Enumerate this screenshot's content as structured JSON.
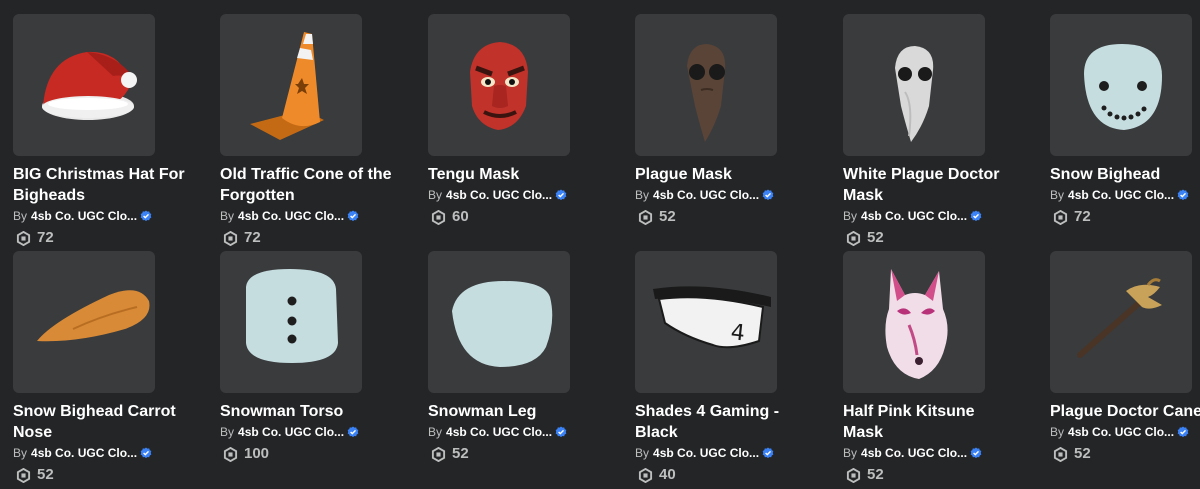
{
  "items": [
    {
      "name": "BIG Christmas Hat For Bigheads",
      "by": "By",
      "creator": "4sb Co. UGC Clo...",
      "price": "72",
      "icon": "santa-hat"
    },
    {
      "name": "Old Traffic Cone of the Forgotten",
      "by": "By",
      "creator": "4sb Co. UGC Clo...",
      "price": "72",
      "icon": "traffic-cone"
    },
    {
      "name": "Tengu Mask",
      "by": "By",
      "creator": "4sb Co. UGC Clo...",
      "price": "60",
      "icon": "tengu-mask"
    },
    {
      "name": "Plague Mask",
      "by": "By",
      "creator": "4sb Co. UGC Clo...",
      "price": "52",
      "icon": "plague-mask"
    },
    {
      "name": "White Plague Doctor Mask",
      "by": "By",
      "creator": "4sb Co. UGC Clo...",
      "price": "52",
      "icon": "white-plague-mask"
    },
    {
      "name": "Snow Bighead",
      "by": "By",
      "creator": "4sb Co. UGC Clo...",
      "price": "72",
      "icon": "snow-bighead"
    },
    {
      "name": "Snow Bighead Carrot Nose",
      "by": "By",
      "creator": "4sb Co. UGC Clo...",
      "price": "52",
      "icon": "carrot-nose"
    },
    {
      "name": "Snowman Torso",
      "by": "By",
      "creator": "4sb Co. UGC Clo...",
      "price": "100",
      "icon": "snowman-torso"
    },
    {
      "name": "Snowman Leg",
      "by": "By",
      "creator": "4sb Co. UGC Clo...",
      "price": "52",
      "icon": "snowman-leg"
    },
    {
      "name": "Shades 4 Gaming - Black",
      "by": "By",
      "creator": "4sb Co. UGC Clo...",
      "price": "40",
      "icon": "shades"
    },
    {
      "name": "Half Pink Kitsune Mask",
      "by": "By",
      "creator": "4sb Co. UGC Clo...",
      "price": "52",
      "icon": "kitsune-mask"
    },
    {
      "name": "Plague Doctor Cane",
      "by": "By",
      "creator": "4sb Co. UGC Clo...",
      "price": "52",
      "icon": "cane"
    }
  ],
  "colors": {
    "background": "#232527",
    "thumb": "#393b3d",
    "verified": "#3b82f6"
  }
}
